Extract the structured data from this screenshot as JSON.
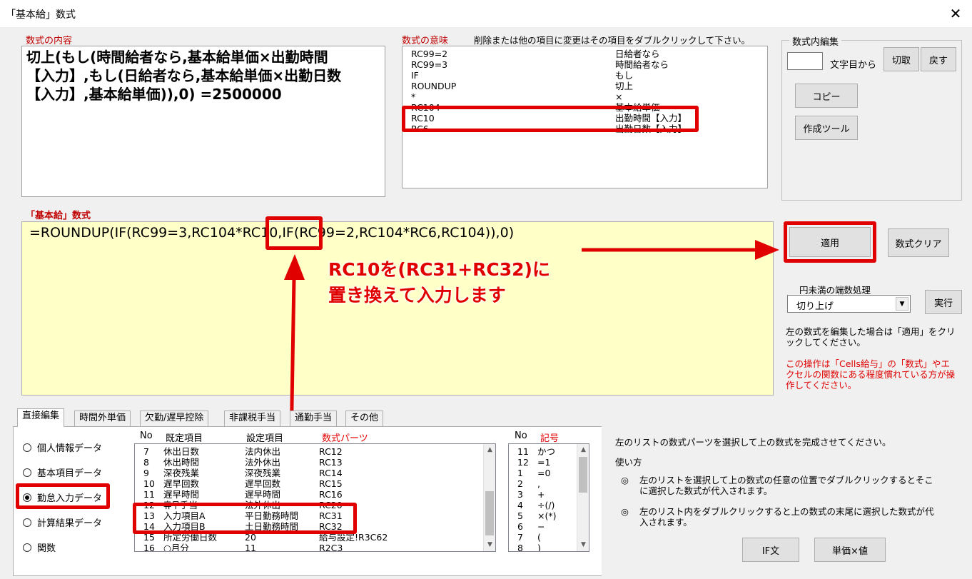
{
  "window": {
    "title": "「基本給」数式",
    "close_icon": "✕"
  },
  "formula_content": {
    "label": "数式の内容",
    "text": "切上(もし(時間給者なら,基本給単価×出勤時間\n【入力】,もし(日給者なら,基本給単価×出勤日数\n【入力】,基本給単価)),0) =2500000"
  },
  "meaning": {
    "label": "数式の意味",
    "hint": "削除または他の項目に変更はその項目をダブルクリックして下さい。",
    "rows": [
      {
        "code": "RC99=2",
        "meaning": "日給者なら"
      },
      {
        "code": "RC99=3",
        "meaning": "時間給者なら"
      },
      {
        "code": "IF",
        "meaning": "もし"
      },
      {
        "code": "ROUNDUP",
        "meaning": "切上"
      },
      {
        "code": "*",
        "meaning": "×"
      },
      {
        "code": "RC104",
        "meaning": "基本給単価"
      },
      {
        "code": "RC10",
        "meaning": "出勤時間【入力】"
      },
      {
        "code": "RC6",
        "meaning": "出勤日数【入力】"
      }
    ]
  },
  "edit_group": {
    "title": "数式内編集",
    "char_pos_value": "",
    "char_pos_label": "文字目から",
    "cut": "切取",
    "revert": "戻す",
    "copy": "コピー",
    "create_tool": "作成ツール"
  },
  "formula_editor": {
    "label": "「基本給」数式",
    "text": "=ROUNDUP(IF(RC99=3,RC104*RC10,IF(RC99=2,RC104*RC6,RC104)),0)"
  },
  "actions": {
    "apply": "適用",
    "clear": "数式クリア"
  },
  "rounding": {
    "label": "円未満の端数処理",
    "selected": "切り上げ",
    "execute": "実行"
  },
  "notes": {
    "edit_note": "左の数式を編集した場合は「適用」をクリックしてください。",
    "warning": "この操作は「Cells給与」の「数式」やエクセルの関数にある程度慣れている方が操作してください。"
  },
  "annotation": {
    "line1": "RC10を(RC31+RC32)に",
    "line2": "置き換えて入力します"
  },
  "tabs": [
    "直接編集",
    "時間外単価",
    "欠勤/遅早控除",
    "非課税手当",
    "通勤手当",
    "その他"
  ],
  "data_sources": [
    "個人情報データ",
    "基本項目データ",
    "勤怠入力データ",
    "計算結果データ",
    "関数"
  ],
  "selected_source": "勤怠入力データ",
  "items_list": {
    "headers": {
      "no": "No",
      "default": "既定項目",
      "setting": "設定項目",
      "parts": "数式パーツ"
    },
    "rows": [
      {
        "no": "7",
        "default": "休出日数",
        "setting": "法内休出",
        "parts": "RC12"
      },
      {
        "no": "8",
        "default": "休出時間",
        "setting": "法外休出",
        "parts": "RC13"
      },
      {
        "no": "9",
        "default": "深夜残業",
        "setting": "深夜残業",
        "parts": "RC14"
      },
      {
        "no": "10",
        "default": "遅早回数",
        "setting": "遅早回数",
        "parts": "RC15"
      },
      {
        "no": "11",
        "default": "遅早時間",
        "setting": "遅早時間",
        "parts": "RC16"
      },
      {
        "no": "12",
        "default": "휴무手当",
        "setting": "法外休出",
        "parts": "RC20"
      },
      {
        "no": "13",
        "default": "入力項目A",
        "setting": "平日勤務時間",
        "parts": "RC31"
      },
      {
        "no": "14",
        "default": "入力項目B",
        "setting": "土日勤務時間",
        "parts": "RC32"
      },
      {
        "no": "15",
        "default": "所定労働日数",
        "setting": "20",
        "parts": "給与設定!R3C62"
      },
      {
        "no": "16",
        "default": "○月分",
        "setting": "11",
        "parts": "R2C3"
      }
    ]
  },
  "symbols_list": {
    "headers": {
      "no": "No",
      "symbol": "記号"
    },
    "rows": [
      {
        "no": "11",
        "sym": "かつ"
      },
      {
        "no": "12",
        "sym": "=1"
      },
      {
        "no": "1",
        "sym": "=0"
      },
      {
        "no": "2",
        "sym": ","
      },
      {
        "no": "3",
        "sym": "+"
      },
      {
        "no": "4",
        "sym": "÷(/)"
      },
      {
        "no": "5",
        "sym": "×(*)"
      },
      {
        "no": "6",
        "sym": "−"
      },
      {
        "no": "7",
        "sym": "("
      },
      {
        "no": "8",
        "sym": ")"
      }
    ]
  },
  "help": {
    "intro": "左のリストの数式パーツを選択して上の数式を完成させてください。",
    "usage_title": "使い方",
    "bullet_icon": "◎",
    "item1": "左のリストを選択して上の数式の任意の位置でダブルクリックするとそこに選択した数式が代入されます。",
    "item2": "左のリスト内をダブルクリックすると上の数式の末尾に選択した数式が代入されます。"
  },
  "bottom_buttons": {
    "if": "IF文",
    "unit_price": "単価×値"
  }
}
